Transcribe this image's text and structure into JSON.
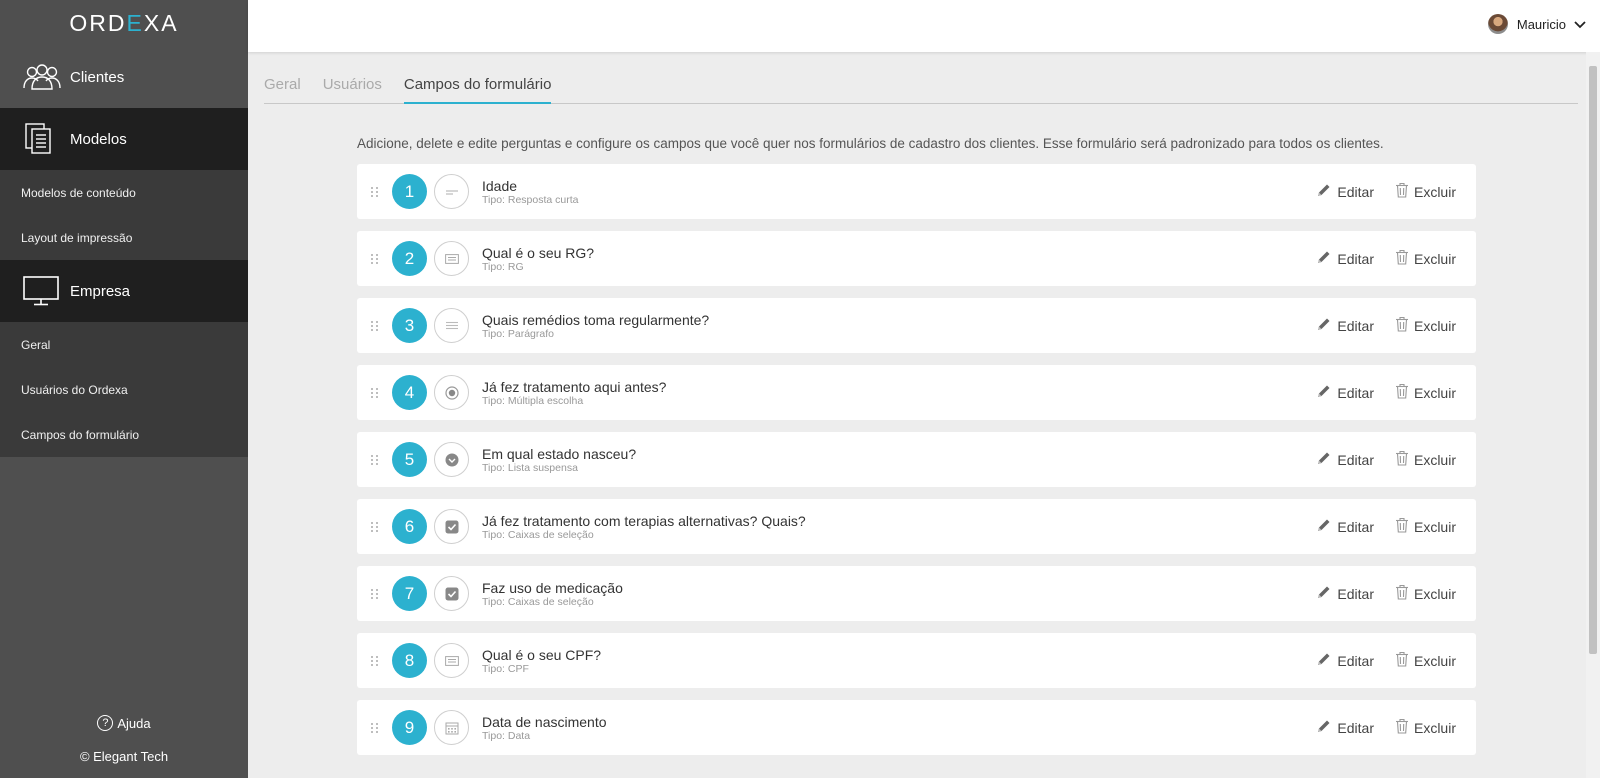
{
  "brand": {
    "logo_pre": "ORD",
    "logo_accent": "E",
    "logo_post": "XA",
    "accent_color": "#2cb1cf"
  },
  "sidebar": {
    "clientes": "Clientes",
    "modelos": "Modelos",
    "modelos_conteudo": "Modelos de conteúdo",
    "layout_impressao": "Layout de impressão",
    "empresa": "Empresa",
    "geral": "Geral",
    "usuarios": "Usuários do Ordexa",
    "campos": "Campos do formulário",
    "help": "Ajuda",
    "copyright": "© Elegant Tech"
  },
  "header": {
    "user_name": "Mauricio"
  },
  "tabs": [
    {
      "label": "Geral"
    },
    {
      "label": "Usuários"
    },
    {
      "label": "Campos do formulário"
    }
  ],
  "description": "Adicione, delete e edite perguntas e configure os campos que você quer nos formulários de cadastro dos clientes. Esse formulário será padronizado para todos os clientes.",
  "actions": {
    "edit": "Editar",
    "delete": "Excluir"
  },
  "fields": [
    {
      "num": "1",
      "title": "Idade",
      "type": "Tipo: Resposta curta",
      "icon": "short-text-icon"
    },
    {
      "num": "2",
      "title": "Qual é o seu RG?",
      "type": "Tipo: RG",
      "icon": "id-card-icon"
    },
    {
      "num": "3",
      "title": "Quais remédios toma regularmente?",
      "type": "Tipo: Parágrafo",
      "icon": "paragraph-icon"
    },
    {
      "num": "4",
      "title": "Já fez tratamento aqui antes?",
      "type": "Tipo: Múltipla escolha",
      "icon": "radio-icon"
    },
    {
      "num": "5",
      "title": "Em qual estado nasceu?",
      "type": "Tipo: Lista suspensa",
      "icon": "dropdown-icon"
    },
    {
      "num": "6",
      "title": "Já fez tratamento com terapias alternativas? Quais?",
      "type": "Tipo: Caixas de seleção",
      "icon": "checkbox-icon"
    },
    {
      "num": "7",
      "title": "Faz uso de medicação",
      "type": "Tipo: Caixas de seleção",
      "icon": "checkbox-icon"
    },
    {
      "num": "8",
      "title": "Qual é o seu CPF?",
      "type": "Tipo: CPF",
      "icon": "id-card-icon"
    },
    {
      "num": "9",
      "title": "Data de nascimento",
      "type": "Tipo: Data",
      "icon": "calendar-icon"
    }
  ]
}
